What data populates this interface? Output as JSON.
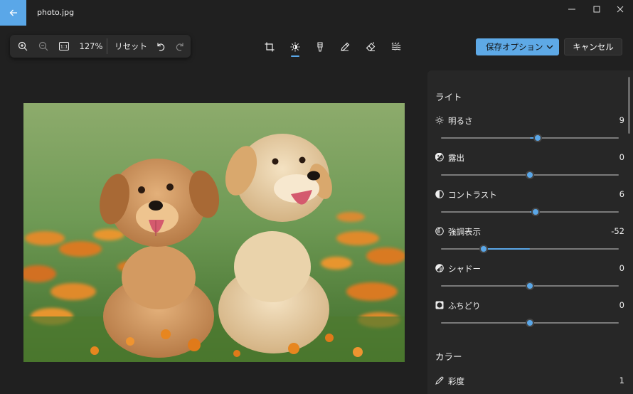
{
  "window": {
    "file_name": "photo.jpg"
  },
  "zoom_toolbar": {
    "zoom_level": "127%",
    "reset_label": "リセット",
    "actual_size_label": "1:1"
  },
  "actions": {
    "save_label": "保存オプション",
    "cancel_label": "キャンセル"
  },
  "panel": {
    "light_title": "ライト",
    "color_title": "カラー",
    "adjustments": [
      {
        "label": "明るさ",
        "value": "9",
        "level": 9,
        "icon": "sun-icon"
      },
      {
        "label": "露出",
        "value": "0",
        "level": 0,
        "icon": "exposure-icon"
      },
      {
        "label": "コントラスト",
        "value": "6",
        "level": 6,
        "icon": "contrast-icon"
      },
      {
        "label": "強調表示",
        "value": "-52",
        "level": -52,
        "icon": "highlights-icon"
      },
      {
        "label": "シャドー",
        "value": "0",
        "level": 0,
        "icon": "shadows-icon"
      },
      {
        "label": "ふちどり",
        "value": "0",
        "level": 0,
        "icon": "vignette-icon"
      }
    ],
    "color_adjustments": [
      {
        "label": "彩度",
        "value": "1",
        "icon": "eyedropper-icon"
      }
    ]
  },
  "colors": {
    "accent": "#5aa7e8",
    "background": "#202020",
    "panel": "#272727"
  }
}
